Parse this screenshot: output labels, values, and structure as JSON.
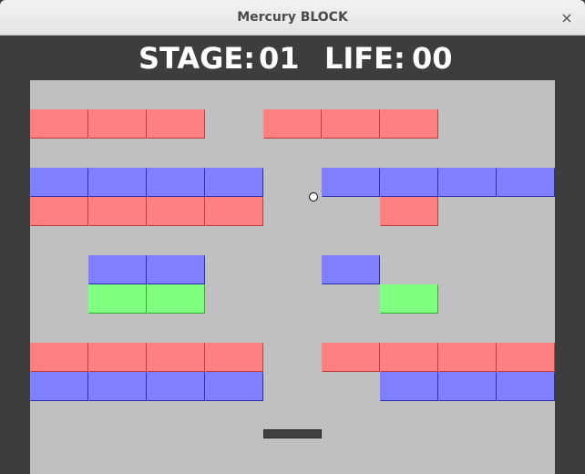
{
  "window": {
    "title": "Mercury BLOCK",
    "close_glyph": "×"
  },
  "hud": {
    "stage_label": "STAGE:",
    "stage_value": "01",
    "life_label": "LIFE:",
    "life_value": "00"
  },
  "colors": {
    "red": "#ff8080",
    "red_edge": "#c03c3c",
    "blue": "#8080ff",
    "blue_edge": "#2a2ab4",
    "green": "#80ff80",
    "green_edge": "#30b030",
    "field": "#c0c0c0",
    "wall": "#3d3d3d"
  },
  "grid": {
    "columns": 9,
    "rows": [
      "",
      "r r r   r r r",
      "",
      "b b b b   b b b b",
      "r r r r     r",
      "",
      "  b b     b",
      "  g g       g",
      "",
      "r r r r   r r r r",
      "b b b b     b b b"
    ]
  },
  "paddle": {
    "label": ""
  }
}
